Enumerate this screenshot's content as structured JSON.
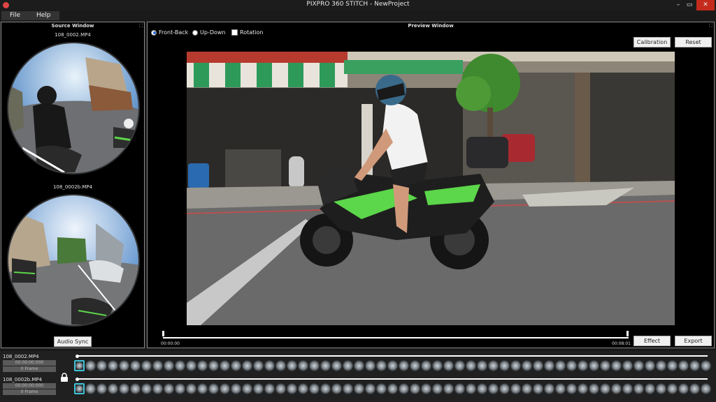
{
  "window": {
    "title": "PIXPRO 360 STITCH - NewProject",
    "minimize": "–",
    "maximize": "▭",
    "close": "✕"
  },
  "menu": {
    "file": "File",
    "help": "Help"
  },
  "source": {
    "title": "Source Window",
    "front_file": "108_0002.MP4",
    "back_file": "108_0002b.MP4",
    "audio_sync": "Audio Sync"
  },
  "preview": {
    "title": "Preview Window",
    "options": [
      {
        "label": "Front-Back",
        "selected": true
      },
      {
        "label": "Up-Down",
        "selected": false
      },
      {
        "label": "Rotation",
        "checked": false
      }
    ],
    "calibration": "Calibration",
    "reset": "Reset",
    "time_start": "00:00:00",
    "time_end": "00:08:01",
    "effect": "Effect",
    "export": "Export"
  },
  "tracks": [
    {
      "name": "108_0002.MP4",
      "timecode": "00:00:00:000",
      "frame": "0 Frame"
    },
    {
      "name": "108_0002b.MP4",
      "timecode": "00:00:00:000",
      "frame": "0 Frame"
    }
  ],
  "colors": {
    "accent": "#3ec4d8",
    "close": "#c42b1c",
    "awning_green": "#2e9a5a",
    "bike_green": "#5cd64a"
  }
}
